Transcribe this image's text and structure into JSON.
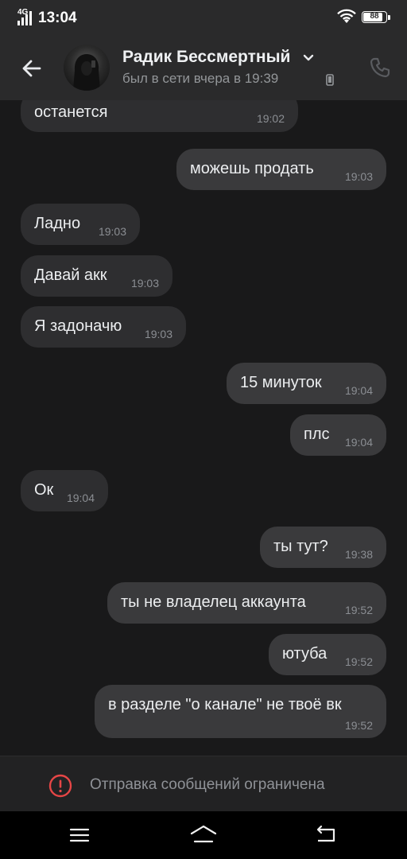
{
  "status_bar": {
    "network": "4G",
    "time": "13:04",
    "battery": "88"
  },
  "header": {
    "contact_name": "Радик Бессмертный",
    "last_seen": "был в сети вчера в 19:39",
    "icons": [
      "back-arrow-icon",
      "chevron-down-icon",
      "phone-icon",
      "call-icon"
    ]
  },
  "messages": [
    {
      "text": "останется",
      "time": "19:02",
      "dir": "in"
    },
    {
      "text": "можешь продать",
      "time": "19:03",
      "dir": "out"
    },
    {
      "text": "Ладно",
      "time": "19:03",
      "dir": "in"
    },
    {
      "text": "Давай акк",
      "time": "19:03",
      "dir": "in"
    },
    {
      "text": "Я задоначю",
      "time": "19:03",
      "dir": "in"
    },
    {
      "text": "15 минуток",
      "time": "19:04",
      "dir": "out"
    },
    {
      "text": "плс",
      "time": "19:04",
      "dir": "out"
    },
    {
      "text": "Ок",
      "time": "19:04",
      "dir": "in"
    },
    {
      "text": "ты тут?",
      "time": "19:38",
      "dir": "out"
    },
    {
      "text": "ты не владелец аккаунта",
      "time": "19:52",
      "dir": "out"
    },
    {
      "text": "ютуба",
      "time": "19:52",
      "dir": "out"
    },
    {
      "text": "в разделе \"о канале\" не твоё вк",
      "time": "19:52",
      "dir": "out"
    }
  ],
  "restriction": {
    "text": "Отправка сообщений ограничена",
    "icon": "warning-icon",
    "color": "#e64646"
  },
  "nav": {
    "icons": [
      "menu-icon",
      "home-icon",
      "back-icon"
    ]
  }
}
